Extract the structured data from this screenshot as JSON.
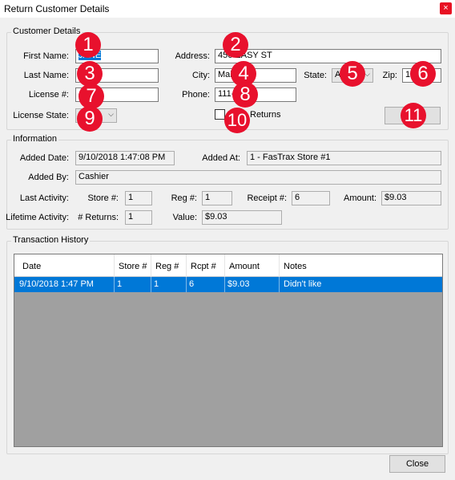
{
  "window": {
    "title": "Return Customer Details",
    "close_glyph": "×"
  },
  "customer_details": {
    "group_label": "Customer Details",
    "first_name_label": "First Name:",
    "first_name_value": "JANE",
    "address_label": "Address:",
    "address_value": "456 EASY ST",
    "last_name_label": "Last Name:",
    "last_name_value": "",
    "city_label": "City:",
    "city_value": "Main",
    "state_label": "State:",
    "state_value": "AZ",
    "zip_label": "Zip:",
    "zip_value": "1",
    "license_label": "License #:",
    "license_value": "4",
    "phone_label": "Phone:",
    "phone_value": "111-   -1111",
    "license_state_label": "License State:",
    "license_state_value": "",
    "block_returns_label": "Returns",
    "block_returns_checked": false
  },
  "information": {
    "group_label": "Information",
    "added_date_label": "Added Date:",
    "added_date_value": "9/10/2018 1:47:08 PM",
    "added_at_label": "Added At:",
    "added_at_value": "1 - FasTrax Store #1",
    "added_by_label": "Added By:",
    "added_by_value": "Cashier",
    "last_activity_label": "Last Activity:",
    "store_label": "Store #:",
    "store_value": "1",
    "reg_label": "Reg #:",
    "reg_value": "1",
    "receipt_label": "Receipt #:",
    "receipt_value": "6",
    "amount_label": "Amount:",
    "amount_value": "$9.03",
    "lifetime_activity_label": "Lifetime Activity:",
    "returns_label": "# Returns:",
    "returns_value": "1",
    "value_label": "Value:",
    "value_value": "$9.03"
  },
  "transaction_history": {
    "group_label": "Transaction History",
    "columns": [
      "Date",
      "Store #",
      "Reg #",
      "Rcpt #",
      "Amount",
      "Notes"
    ],
    "rows": [
      {
        "date": "9/10/2018 1:47 PM",
        "store": "1",
        "reg": "1",
        "rcpt": "6",
        "amount": "$9.03",
        "notes": "Didn't like"
      }
    ]
  },
  "buttons": {
    "close_label": "Close",
    "unlabeled_button": ""
  },
  "badges": [
    "1",
    "2",
    "3",
    "4",
    "5",
    "6",
    "7",
    "8",
    "9",
    "10",
    "11"
  ],
  "colors": {
    "badge": "#e8112d",
    "selection": "#0078d7",
    "close_button": "#e81123"
  },
  "icons": {
    "combo_arrow": "chevron-down-icon"
  }
}
